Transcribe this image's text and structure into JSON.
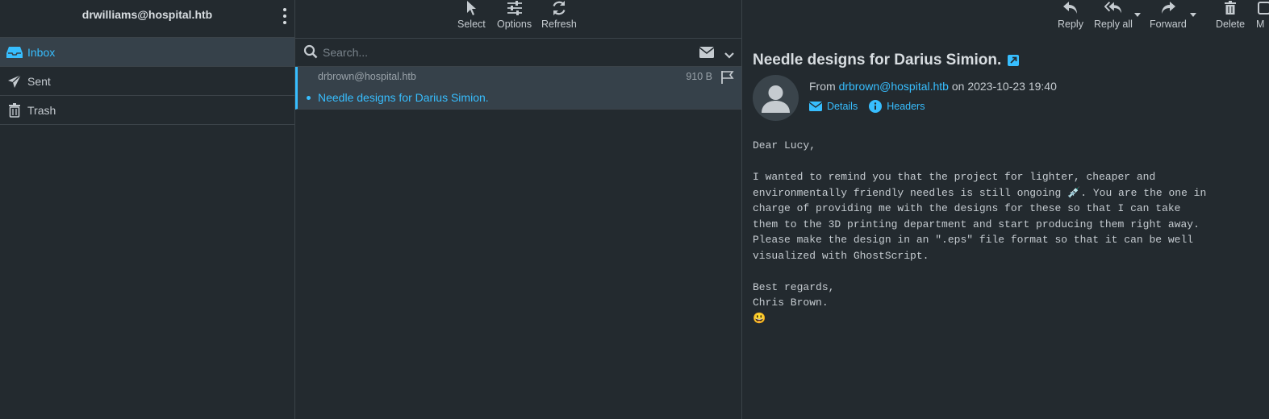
{
  "account": {
    "email": "drwilliams@hospital.htb"
  },
  "folders": [
    {
      "label": "Inbox",
      "icon": "inbox-icon",
      "active": true
    },
    {
      "label": "Sent",
      "icon": "paper-plane-icon",
      "active": false
    },
    {
      "label": "Trash",
      "icon": "trash-icon",
      "active": false
    }
  ],
  "list_toolbar": {
    "select": "Select",
    "options": "Options",
    "refresh": "Refresh"
  },
  "search": {
    "placeholder": "Search..."
  },
  "messages": [
    {
      "from": "drbrown@hospital.htb",
      "size": "910 B",
      "subject": "Needle designs for Darius Simion.",
      "unread": true
    }
  ],
  "msg_toolbar": {
    "reply": "Reply",
    "reply_all": "Reply all",
    "forward": "Forward",
    "delete": "Delete",
    "more": "M"
  },
  "message": {
    "subject": "Needle designs for Darius Simion.",
    "from_prefix": "From",
    "from": "drbrown@hospital.htb",
    "on": "on",
    "date": "2023-10-23 19:40",
    "details": "Details",
    "headers": "Headers",
    "body": "Dear Lucy,\n\nI wanted to remind you that the project for lighter, cheaper and\nenvironmentally friendly needles is still ongoing 💉. You are the one in\ncharge of providing me with the designs for these so that I can take\nthem to the 3D printing department and start producing them right away.\nPlease make the design in an \".eps\" file format so that it can be well\nvisualized with GhostScript.\n\nBest regards,\nChris Brown.\n😃"
  },
  "colors": {
    "accent": "#37beff",
    "background": "#232a2f",
    "selected": "#36414a"
  }
}
